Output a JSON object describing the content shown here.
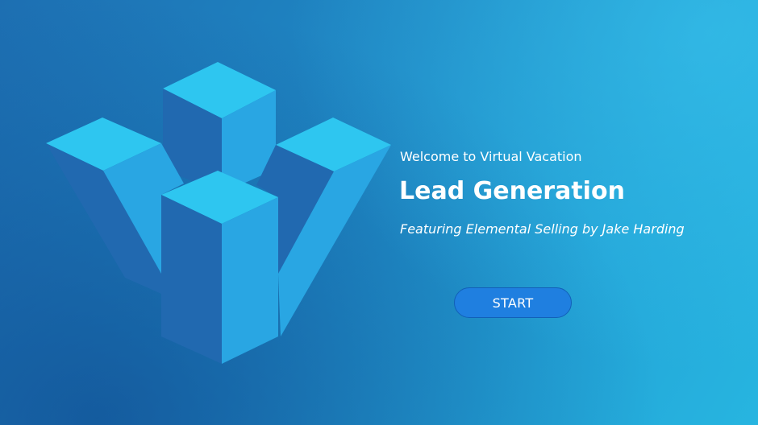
{
  "welcome_text": "Welcome to Virtual Vacation",
  "title": "Lead Generation",
  "subtitle": "Featuring Elemental Selling by Jake Harding",
  "start_button": {
    "label": "START"
  },
  "logo": {
    "icon": "stacked-cubes-v-logo-icon"
  },
  "colors": {
    "background_light": "#27b5e0",
    "background_dark": "#1d6fb2",
    "logo_top": "#2ec6f0",
    "logo_light_side": "#29a6e3",
    "logo_dark_side": "#2169b0",
    "button": "#1f7fe0"
  }
}
